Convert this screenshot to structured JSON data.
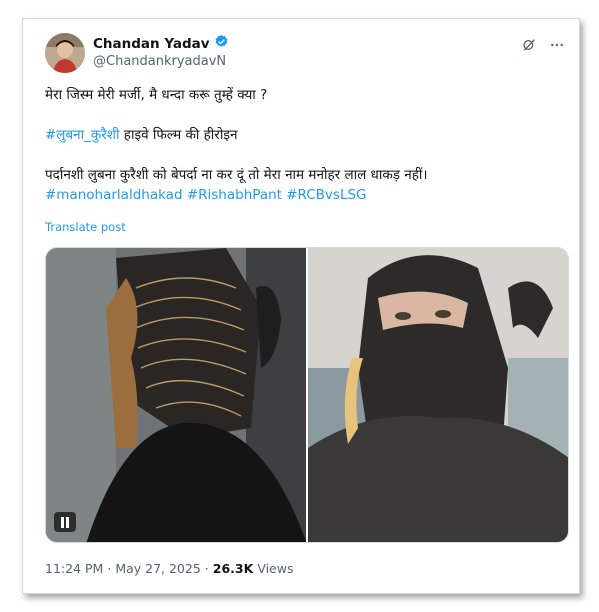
{
  "author": {
    "name": "Chandan Yadav",
    "handle": "@ChandankryadavN",
    "verified_color": "#1d9bf0"
  },
  "icons": {
    "grok": "grok-icon",
    "more": "more-icon",
    "verified": "verified-badge-icon",
    "pause": "pause-icon"
  },
  "post": {
    "line1": "मेरा जिस्म मेरी मर्जी, मै धन्दा करू तुम्हें क्या ?",
    "line2_tag": "#लुबना_कुरैशी",
    "line2_rest": " हाइवे फिल्म की हीरोइन",
    "line3": "पर्दानशी  लुबना कुरैशी  को बेपर्दा ना कर दूं तो मेरा नाम मनोहर लाल धाकड़ नहीं।",
    "hashtags": [
      "#manoharlaldhakad",
      "#RishabhPant",
      "#RCBvsLSG"
    ],
    "translate": "Translate post"
  },
  "meta": {
    "time": "11:24 PM",
    "sep1": "·",
    "date": "May 27, 2025",
    "sep2": "·",
    "views_count": "26.3K",
    "views_label": "Views"
  },
  "colors": {
    "link": "#1d9bf0",
    "muted": "#536471",
    "text": "#0f1419"
  }
}
